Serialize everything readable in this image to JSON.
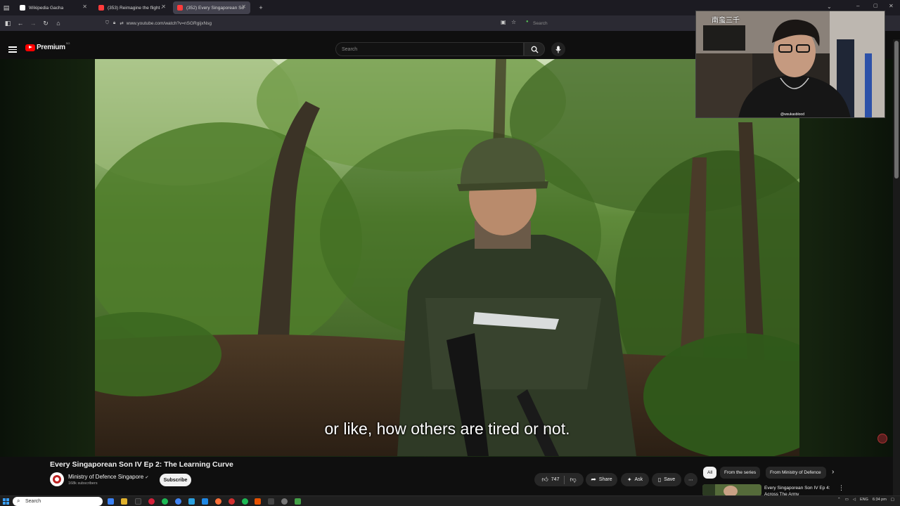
{
  "browser": {
    "tabs": [
      {
        "label": "Wikipedia Gacha",
        "favicon_color": "#ffffff",
        "active": false
      },
      {
        "label": "(353) Reimagine the flight -",
        "favicon_color": "#ff3b3b",
        "active": false
      },
      {
        "label": "(352) Every Singaporean So",
        "favicon_color": "#ff3b3b",
        "active": true
      }
    ],
    "url": "www.youtube.com/watch?v=nSGRgijxNsg",
    "search_placeholder": "Search"
  },
  "youtube": {
    "logo_text": "Premium",
    "logo_sup": "SG",
    "search_placeholder": "Search"
  },
  "video": {
    "caption": "or like, how others are tired or not.",
    "title": "Every Singaporean Son IV Ep 2: The Learning Curve"
  },
  "webcam": {
    "title": "南蛮三千",
    "handle": "@wsukasblood"
  },
  "channel": {
    "name": "Ministry of Defence Singapore",
    "subscribers": "168k subscribers",
    "subscribe_label": "Subscribe"
  },
  "actions": {
    "likes": "747",
    "share": "Share",
    "ask": "Ask",
    "save": "Save"
  },
  "chips": [
    "All",
    "From the series",
    "From Ministry of Defence"
  ],
  "recommended": {
    "title": "Every Singaporean Son IV Ep 4: Across The Army"
  },
  "taskbar": {
    "search_placeholder": "Search",
    "language": "ENG",
    "time": "6:34 pm"
  },
  "colors": {
    "youtube_red": "#ff0000",
    "background": "#0f0f0f",
    "accent_windows": "#3aa0ff"
  }
}
